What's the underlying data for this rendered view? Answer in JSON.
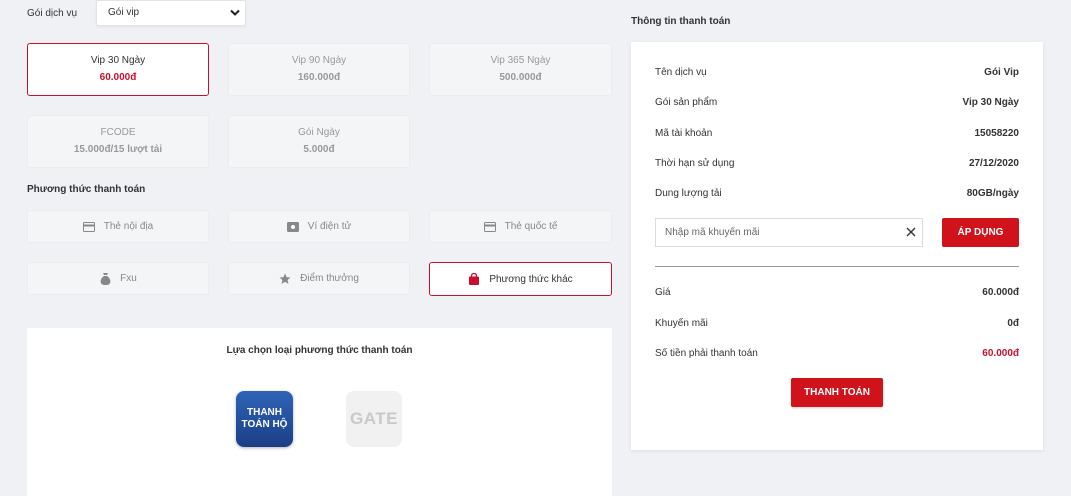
{
  "service": {
    "label": "Gói dịch vụ",
    "selected": "Gói vip"
  },
  "packages": [
    {
      "name": "Vip 30 Ngày",
      "price": "60.000đ",
      "selected": true
    },
    {
      "name": "Vip 90 Ngày",
      "price": "160.000đ",
      "selected": false
    },
    {
      "name": "Vip 365 Ngày",
      "price": "500.000đ",
      "selected": false
    },
    {
      "name": "FCODE",
      "price": "15.000đ/15 lượt tải",
      "selected": false
    },
    {
      "name": "Gói Ngày",
      "price": "5.000đ",
      "selected": false
    }
  ],
  "payment_methods": {
    "title": "Phương thức thanh toán",
    "items": [
      {
        "label": "Thẻ nội địa",
        "icon": "card-icon"
      },
      {
        "label": "Ví điện tử",
        "icon": "wallet-icon"
      },
      {
        "label": "Thẻ quốc tế",
        "icon": "card-icon"
      },
      {
        "label": "Fxu",
        "icon": "money-bag-icon"
      },
      {
        "label": "Điểm thưởng",
        "icon": "star-icon"
      },
      {
        "label": "Phương thức khác",
        "icon": "shopping-bag-icon",
        "selected": true
      }
    ]
  },
  "choose": {
    "title": "Lựa chọn loại phương thức thanh toán",
    "options": [
      {
        "line1": "THANH",
        "line2": "TOÁN HỘ"
      },
      {
        "text": "GATE"
      }
    ]
  },
  "info": {
    "title": "Thông tin thanh toán",
    "rows": [
      {
        "label": "Tên dịch vụ",
        "value": "Gói Vip"
      },
      {
        "label": "Gói sản phẩm",
        "value": "Vip 30 Ngày"
      },
      {
        "label": "Mã tài khoản",
        "value": "15058220"
      },
      {
        "label": "Thời hạn sử dụng",
        "value": "27/12/2020"
      },
      {
        "label": "Dung lượng tải",
        "value": "80GB/ngày"
      }
    ],
    "promo_placeholder": "Nhập mã khuyến mãi",
    "apply_label": "ÁP DỤNG",
    "summary": [
      {
        "label": "Giá",
        "value": "60.000đ"
      },
      {
        "label": "Khuyến mãi",
        "value": "0đ"
      },
      {
        "label": "Số tiền phải thanh toán",
        "value": "60.000đ"
      }
    ],
    "pay_label": "THANH TOÁN"
  },
  "colors": {
    "accent": "#c8102e",
    "button": "#d0121b",
    "background": "#f0f1f5"
  }
}
